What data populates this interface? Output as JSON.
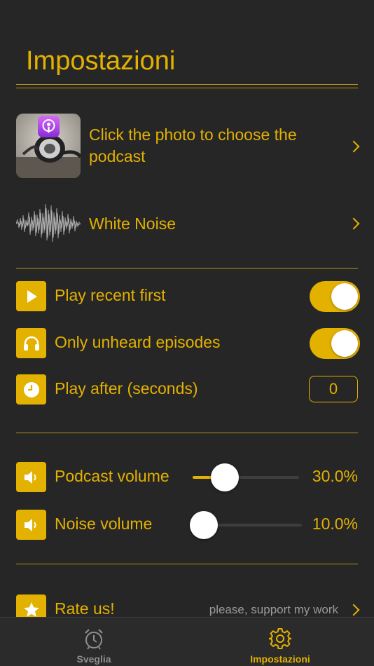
{
  "header": {
    "title": "Impostazioni"
  },
  "podcast_row": {
    "label": "Click the photo to choose the podcast",
    "icon": "podcasts-icon"
  },
  "noise_row": {
    "label": "White Noise"
  },
  "toggles": [
    {
      "label": "Play recent first",
      "icon": "play-icon",
      "on": true
    },
    {
      "label": "Only unheard episodes",
      "icon": "headphones-icon",
      "on": true
    }
  ],
  "play_after": {
    "label": "Play after (seconds)",
    "icon": "clock-icon",
    "value": "0"
  },
  "volumes": [
    {
      "label": "Podcast volume",
      "icon": "speaker-icon",
      "value": 0.3,
      "display": "30.0%"
    },
    {
      "label": "Noise volume",
      "icon": "speaker-icon",
      "value": 0.1,
      "display": "10.0%"
    }
  ],
  "rate": {
    "label": "Rate us!",
    "subtitle": "please, support my work",
    "icon": "star-icon"
  },
  "tabs": [
    {
      "label": "Sveglia",
      "icon": "alarm-clock-icon",
      "active": false
    },
    {
      "label": "Impostazioni",
      "icon": "gear-icon",
      "active": true
    }
  ],
  "colors": {
    "accent": "#e3b100",
    "background": "#262626",
    "inactive": "#8e8e93"
  }
}
